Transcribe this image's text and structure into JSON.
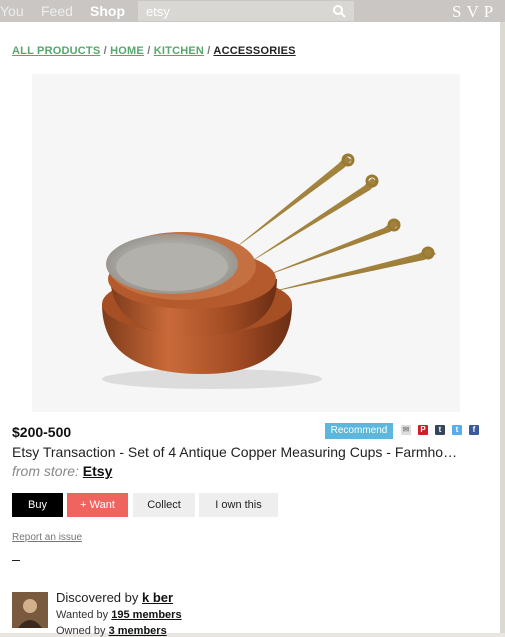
{
  "topbar": {
    "nav": [
      "You",
      "Feed",
      "Shop"
    ],
    "active": "Shop",
    "search_value": "etsy",
    "logo": "SVP"
  },
  "breadcrumb": {
    "items": [
      "ALL PRODUCTS",
      "HOME",
      "KITCHEN",
      "ACCESSORIES"
    ],
    "separator": " / "
  },
  "product": {
    "image_icon": "copper-pans-image",
    "price": "$200-500",
    "recommend_label": "Recommend",
    "share_icons": [
      "email-icon",
      "pinterest-icon",
      "tumblr-icon",
      "twitter-icon",
      "facebook-icon"
    ],
    "title": "Etsy Transaction - Set of 4 Antique Copper Measuring Cups - Farmho…",
    "store_label": "from store:",
    "store_name": "Etsy"
  },
  "actions": {
    "buy": "Buy",
    "want": "+ Want",
    "collect": "Collect",
    "own": "I own this"
  },
  "report": "Report an issue",
  "discovery": {
    "prefix": "Discovered by",
    "user": "k ber",
    "wanted_prefix": "Wanted by",
    "wanted_count": "195 members",
    "owned_prefix": "Owned by",
    "owned_count": "3 members"
  },
  "colors": {
    "topbar": "#c9c6c3",
    "breadcrumb_link": "#5aa56b",
    "recommend": "#5bb7dd",
    "want": "#f06460",
    "buy": "#000000"
  }
}
